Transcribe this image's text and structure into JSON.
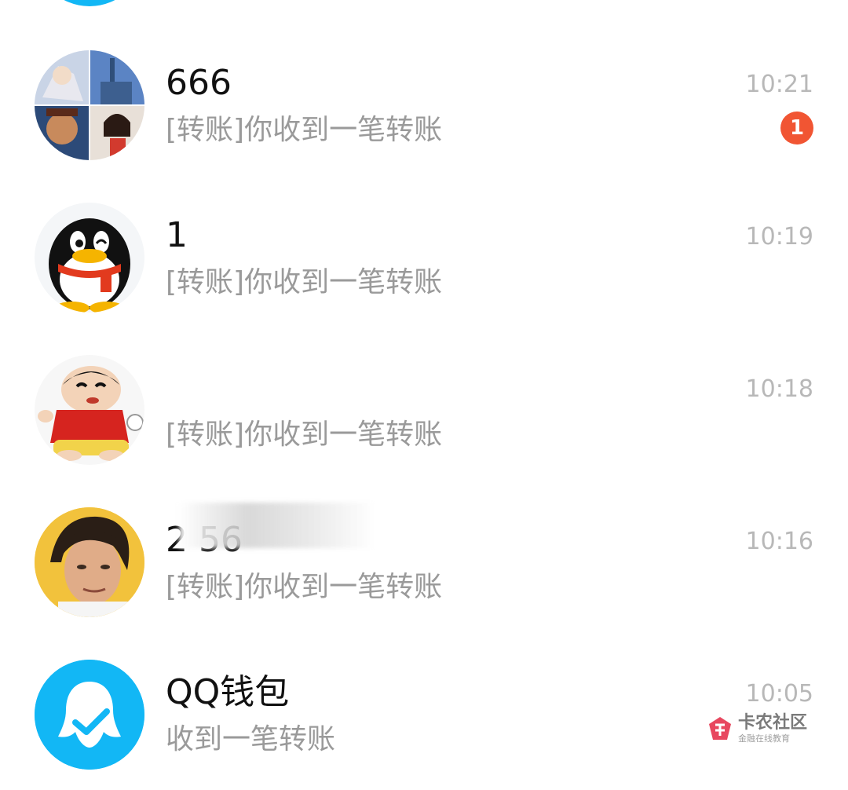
{
  "conversations": [
    {
      "name": "666",
      "preview": "[转账]你收到一笔转账",
      "time": "10:21",
      "unread": "1",
      "avatar_icon": "group-avatar-collage"
    },
    {
      "name": "1",
      "preview": "[转账]你收到一笔转账",
      "time": "10:19",
      "avatar_icon": "qq-penguin-avatar"
    },
    {
      "name": "",
      "preview": "[转账]你收到一笔转账",
      "time": "10:18",
      "avatar_icon": "cartoon-boy-avatar"
    },
    {
      "name": "2          56",
      "preview": "[转账]你收到一笔转账",
      "time": "10:16",
      "avatar_icon": "man-photo-avatar"
    },
    {
      "name": "QQ钱包",
      "preview": "收到一笔转账",
      "time": "10:05",
      "avatar_icon": "qq-wallet-avatar"
    }
  ],
  "watermark": {
    "title": "卡农社区",
    "subtitle": "金融在线教育",
    "icon": "kanong-logo-icon"
  },
  "colors": {
    "qq_blue": "#12b7f5",
    "badge_red": "#f15533",
    "preview_gray": "#9a9a9a",
    "time_gray": "#b8b8b8"
  }
}
